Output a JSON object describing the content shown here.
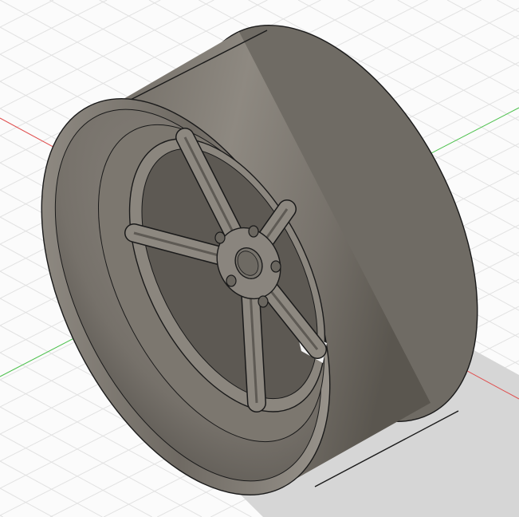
{
  "viewport": {
    "view": "isometric",
    "model": "wheel"
  },
  "colors": {
    "background": "#fbfbfb",
    "grid": "#e2e2e2",
    "x_axis": "#e05050",
    "y_axis": "#4fc24f",
    "shadow": "#d4d4d4",
    "body_light": "#8f8a82",
    "body_dark": "#5e5a54",
    "edge": "#1a1a1a"
  }
}
